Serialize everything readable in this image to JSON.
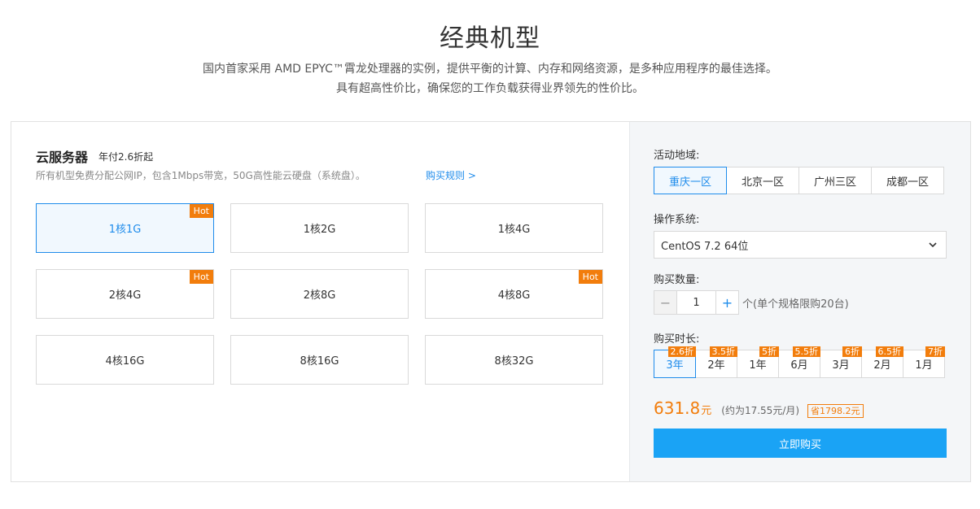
{
  "header": {
    "title": "经典机型",
    "subtitle_line1": "国内首家采用 AMD EPYC™霄龙处理器的实例，提供平衡的计算、内存和网络资源，是多种应用程序的最佳选择。",
    "subtitle_line2": "具有超高性价比，确保您的工作负载获得业界领先的性价比。"
  },
  "server": {
    "title": "云服务器",
    "tag": "年付2.6折起",
    "description": "所有机型免费分配公网IP，包含1Mbps带宽，50G高性能云硬盘（系统盘）。",
    "rule_link": "购买规则 >"
  },
  "specs": [
    {
      "label": "1核1G",
      "hot": "Hot",
      "active": true
    },
    {
      "label": "1核2G",
      "hot": "",
      "active": false
    },
    {
      "label": "1核4G",
      "hot": "",
      "active": false
    },
    {
      "label": "2核4G",
      "hot": "Hot",
      "active": false
    },
    {
      "label": "2核8G",
      "hot": "",
      "active": false
    },
    {
      "label": "4核8G",
      "hot": "Hot",
      "active": false
    },
    {
      "label": "4核16G",
      "hot": "",
      "active": false
    },
    {
      "label": "8核16G",
      "hot": "",
      "active": false
    },
    {
      "label": "8核32G",
      "hot": "",
      "active": false
    }
  ],
  "region": {
    "label": "活动地域:",
    "options": [
      "重庆一区",
      "北京一区",
      "广州三区",
      "成都一区"
    ],
    "selected": "重庆一区"
  },
  "os": {
    "label": "操作系统:",
    "value": "CentOS 7.2 64位"
  },
  "quantity": {
    "label": "购买数量:",
    "value": "1",
    "minus": "−",
    "plus": "+",
    "note": "个(单个规格限购20台)"
  },
  "duration": {
    "label": "购买时长:",
    "options": [
      {
        "label": "3年",
        "discount": "2.6折"
      },
      {
        "label": "2年",
        "discount": "3.5折"
      },
      {
        "label": "1年",
        "discount": "5折"
      },
      {
        "label": "6月",
        "discount": "5.5折"
      },
      {
        "label": "3月",
        "discount": "6折"
      },
      {
        "label": "2月",
        "discount": "6.5折"
      },
      {
        "label": "1月",
        "discount": "7折"
      }
    ],
    "selected": "3年"
  },
  "price": {
    "amount": "631.8",
    "unit": "元",
    "monthly": "(约为17.55元/月)",
    "saving": "省1798.2元"
  },
  "buy_button": "立即购买",
  "colors": {
    "accent": "#1f8ceb",
    "orange": "#f27d0c",
    "buy": "#1aa3f5"
  }
}
